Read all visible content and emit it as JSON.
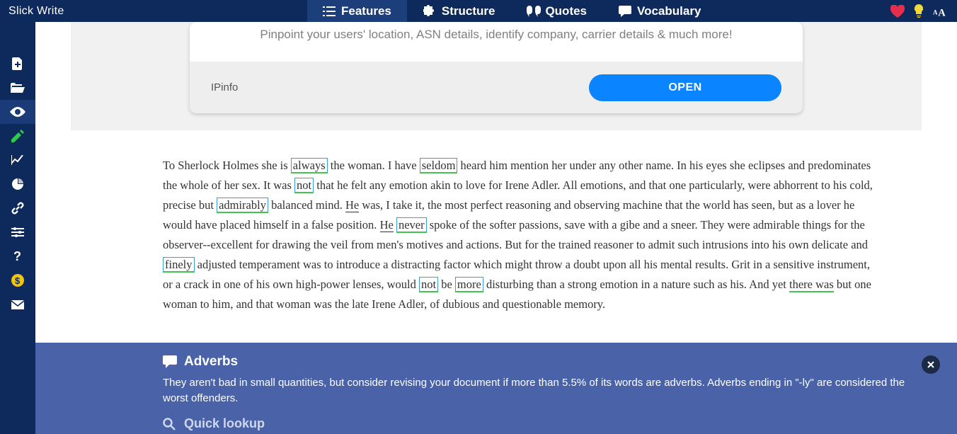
{
  "app_name": "Slick Write",
  "topnav": [
    {
      "label": "Features",
      "icon": "list-icon",
      "active": true
    },
    {
      "label": "Structure",
      "icon": "puzzle-icon",
      "active": false
    },
    {
      "label": "Quotes",
      "icon": "quotes-icon",
      "active": false
    },
    {
      "label": "Vocabulary",
      "icon": "chat-icon",
      "active": false
    }
  ],
  "top_icons": [
    "heart-icon",
    "lightbulb-icon",
    "font-size-icon"
  ],
  "leftbar": [
    {
      "name": "new-file-icon",
      "state": ""
    },
    {
      "name": "open-folder-icon",
      "state": ""
    },
    {
      "name": "eye-icon",
      "state": "active"
    },
    {
      "name": "edit-pencil-icon",
      "state": "green"
    },
    {
      "name": "line-chart-icon",
      "state": ""
    },
    {
      "name": "pie-chart-icon",
      "state": ""
    },
    {
      "name": "link-icon",
      "state": ""
    },
    {
      "name": "settings-sliders-icon",
      "state": ""
    },
    {
      "name": "help-icon",
      "state": ""
    },
    {
      "name": "coin-dollar-icon",
      "state": "yellow"
    },
    {
      "name": "mail-icon",
      "state": ""
    }
  ],
  "ad": {
    "tagline": "Pinpoint your users' location, ASN details, identify company, carrier details & much more!",
    "brand": "IPinfo",
    "cta": "OPEN"
  },
  "passage": {
    "p1_a": "To Sherlock Holmes she is ",
    "w_always": "always",
    "p1_b": " the woman. I have ",
    "w_seldom": "seldom",
    "p1_c": " heard him mention her under any other name. In his eyes she eclipses and predominates the whole of her sex. It was ",
    "w_not1": "not",
    "p1_d": " that he felt any emotion akin to love for Irene Adler. All emotions, and that one particularly, were abhorrent to his cold, precise but ",
    "w_admirably": "admirably",
    "p1_e": " balanced mind. ",
    "w_He1": "He",
    "p1_f": " was, I take it, the most perfect reasoning and observing machine that the world has seen, but as a lover he would have placed himself in a false position. ",
    "w_He2": "He",
    "sp": " ",
    "w_never": "never",
    "p1_g": " spoke of the softer passions, save with a gibe and a sneer. They were admirable things for the observer--excellent for drawing the veil from men's motives and actions. But for the trained reasoner to admit such intrusions into his own delicate and ",
    "w_finely": "finely",
    "p1_h": " adjusted temperament was to introduce a distracting factor which might throw a doubt upon all his mental results. Grit in a sensitive instrument, or a crack in one of his own high-power lenses, would ",
    "w_not2": "not",
    "p1_i": " be ",
    "w_more": "more",
    "p1_j": " disturbing than a strong emotion in a nature such as his. And yet ",
    "w_therewas": "there was",
    "p1_k": " but one woman to him, and that woman was the late Irene Adler, of dubious and questionable memory."
  },
  "panel": {
    "title": "Adverbs",
    "body": "They aren't bad in small quantities, but consider revising your document if more than 5.5% of its words are adverbs. Adverbs ending in \"-ly\" are considered the worst offenders.",
    "quick": "Quick lookup"
  }
}
